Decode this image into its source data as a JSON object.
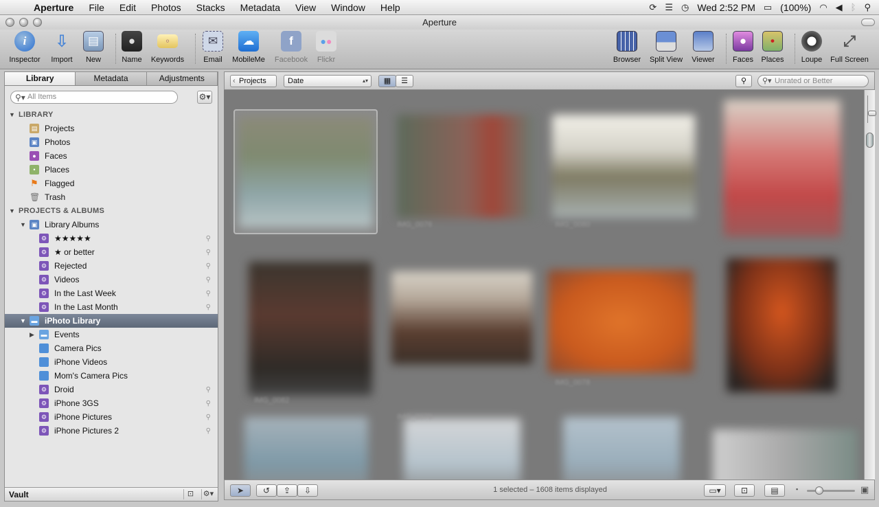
{
  "menubar": {
    "apple": "",
    "items": [
      "Aperture",
      "File",
      "Edit",
      "Photos",
      "Stacks",
      "Metadata",
      "View",
      "Window",
      "Help"
    ],
    "clock": "Wed 2:52 PM",
    "battery": "(100%)"
  },
  "window": {
    "title": "Aperture"
  },
  "toolbar": {
    "inspector": "Inspector",
    "import": "Import",
    "new": "New",
    "name": "Name",
    "keywords": "Keywords",
    "email": "Email",
    "mobileme": "MobileMe",
    "facebook": "Facebook",
    "flickr": "Flickr",
    "browser": "Browser",
    "splitview": "Split View",
    "viewer": "Viewer",
    "faces": "Faces",
    "places": "Places",
    "loupe": "Loupe",
    "fullscreen": "Full Screen"
  },
  "sidebar": {
    "tabs": [
      "Library",
      "Metadata",
      "Adjustments"
    ],
    "search_placeholder": "All Items",
    "library_header": "LIBRARY",
    "library_items": [
      "Projects",
      "Photos",
      "Faces",
      "Places",
      "Flagged",
      "Trash"
    ],
    "projects_header": "PROJECTS & ALBUMS",
    "library_albums": "Library Albums",
    "smart_albums": [
      "★★★★★",
      "★ or better",
      "Rejected",
      "Videos",
      "In the Last Week",
      "In the Last Month"
    ],
    "iphoto_library": "iPhoto Library",
    "iphoto_items": [
      "Events",
      "Camera Pics",
      "iPhone Videos",
      "Mom's Camera Pics",
      "Droid",
      "iPhone 3GS",
      "iPhone Pictures",
      "iPhone Pictures 2"
    ],
    "vault": "Vault"
  },
  "browser_toolbar": {
    "projects_button": "Projects",
    "sort_select": "Date",
    "filter_placeholder": "Unrated or Better"
  },
  "thumb_labels": [
    "IMG_0076",
    "IMG_0080",
    "IMG_0078",
    "IMG_0082",
    "IMG_0079"
  ],
  "status": {
    "text": "1 selected – 1608 items displayed"
  },
  "colors": {
    "selection": "#5d6878",
    "browser_bg": "#7a7a7a"
  }
}
